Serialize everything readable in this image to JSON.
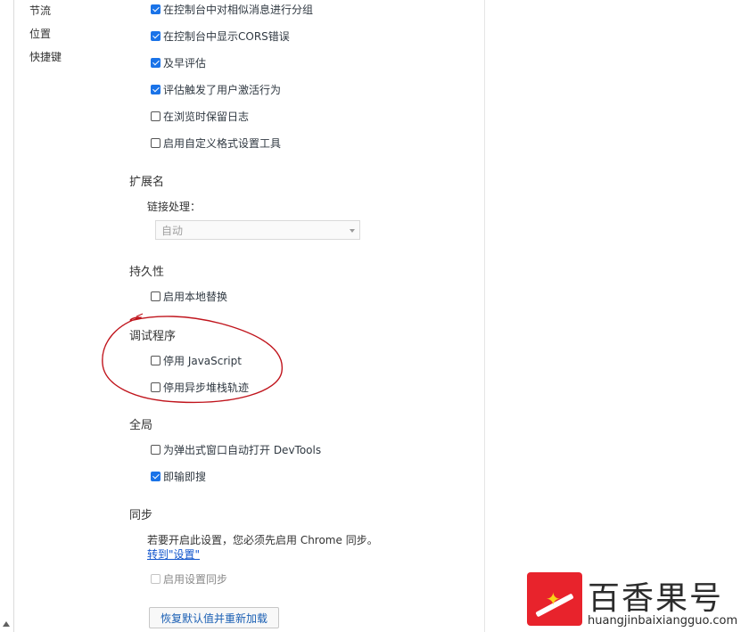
{
  "sidebar": {
    "items": [
      {
        "label": "节流"
      },
      {
        "label": "位置"
      },
      {
        "label": "快捷键"
      }
    ]
  },
  "console": {
    "options": [
      {
        "label": "在控制台中对相似消息进行分组",
        "checked": true
      },
      {
        "label": "在控制台中显示CORS错误",
        "checked": true
      },
      {
        "label": "及早评估",
        "checked": true
      },
      {
        "label": "评估触发了用户激活行为",
        "checked": true
      },
      {
        "label": "在浏览时保留日志",
        "checked": false
      },
      {
        "label": "启用自定义格式设置工具",
        "checked": false
      }
    ]
  },
  "extensions": {
    "title": "扩展名",
    "link_handling_label": "链接处理：",
    "link_handling_value": "自动"
  },
  "persistence": {
    "title": "持久性",
    "options": [
      {
        "label": "启用本地替换",
        "checked": false
      }
    ]
  },
  "debugger": {
    "title": "调试程序",
    "options": [
      {
        "label": "停用 JavaScript",
        "checked": false
      },
      {
        "label": "停用异步堆栈轨迹",
        "checked": false
      }
    ]
  },
  "global": {
    "title": "全局",
    "options": [
      {
        "label": "为弹出式窗口自动打开 DevTools",
        "checked": false
      },
      {
        "label": "即输即搜",
        "checked": true
      }
    ]
  },
  "sync": {
    "title": "同步",
    "notice": "若要开启此设置，您必须先启用 Chrome 同步。",
    "link": "转到\"设置\"",
    "options": [
      {
        "label": "启用设置同步",
        "checked": false,
        "disabled": true
      }
    ]
  },
  "restore_button": "恢复默认值并重新加载",
  "watermark": {
    "title": "百香果号",
    "url": "huangjinbaixiangguo.com"
  },
  "colors": {
    "accent": "#1a73e8",
    "link": "#1155cc",
    "annotation": "#c0141c",
    "watermark_red": "#e8232c"
  }
}
